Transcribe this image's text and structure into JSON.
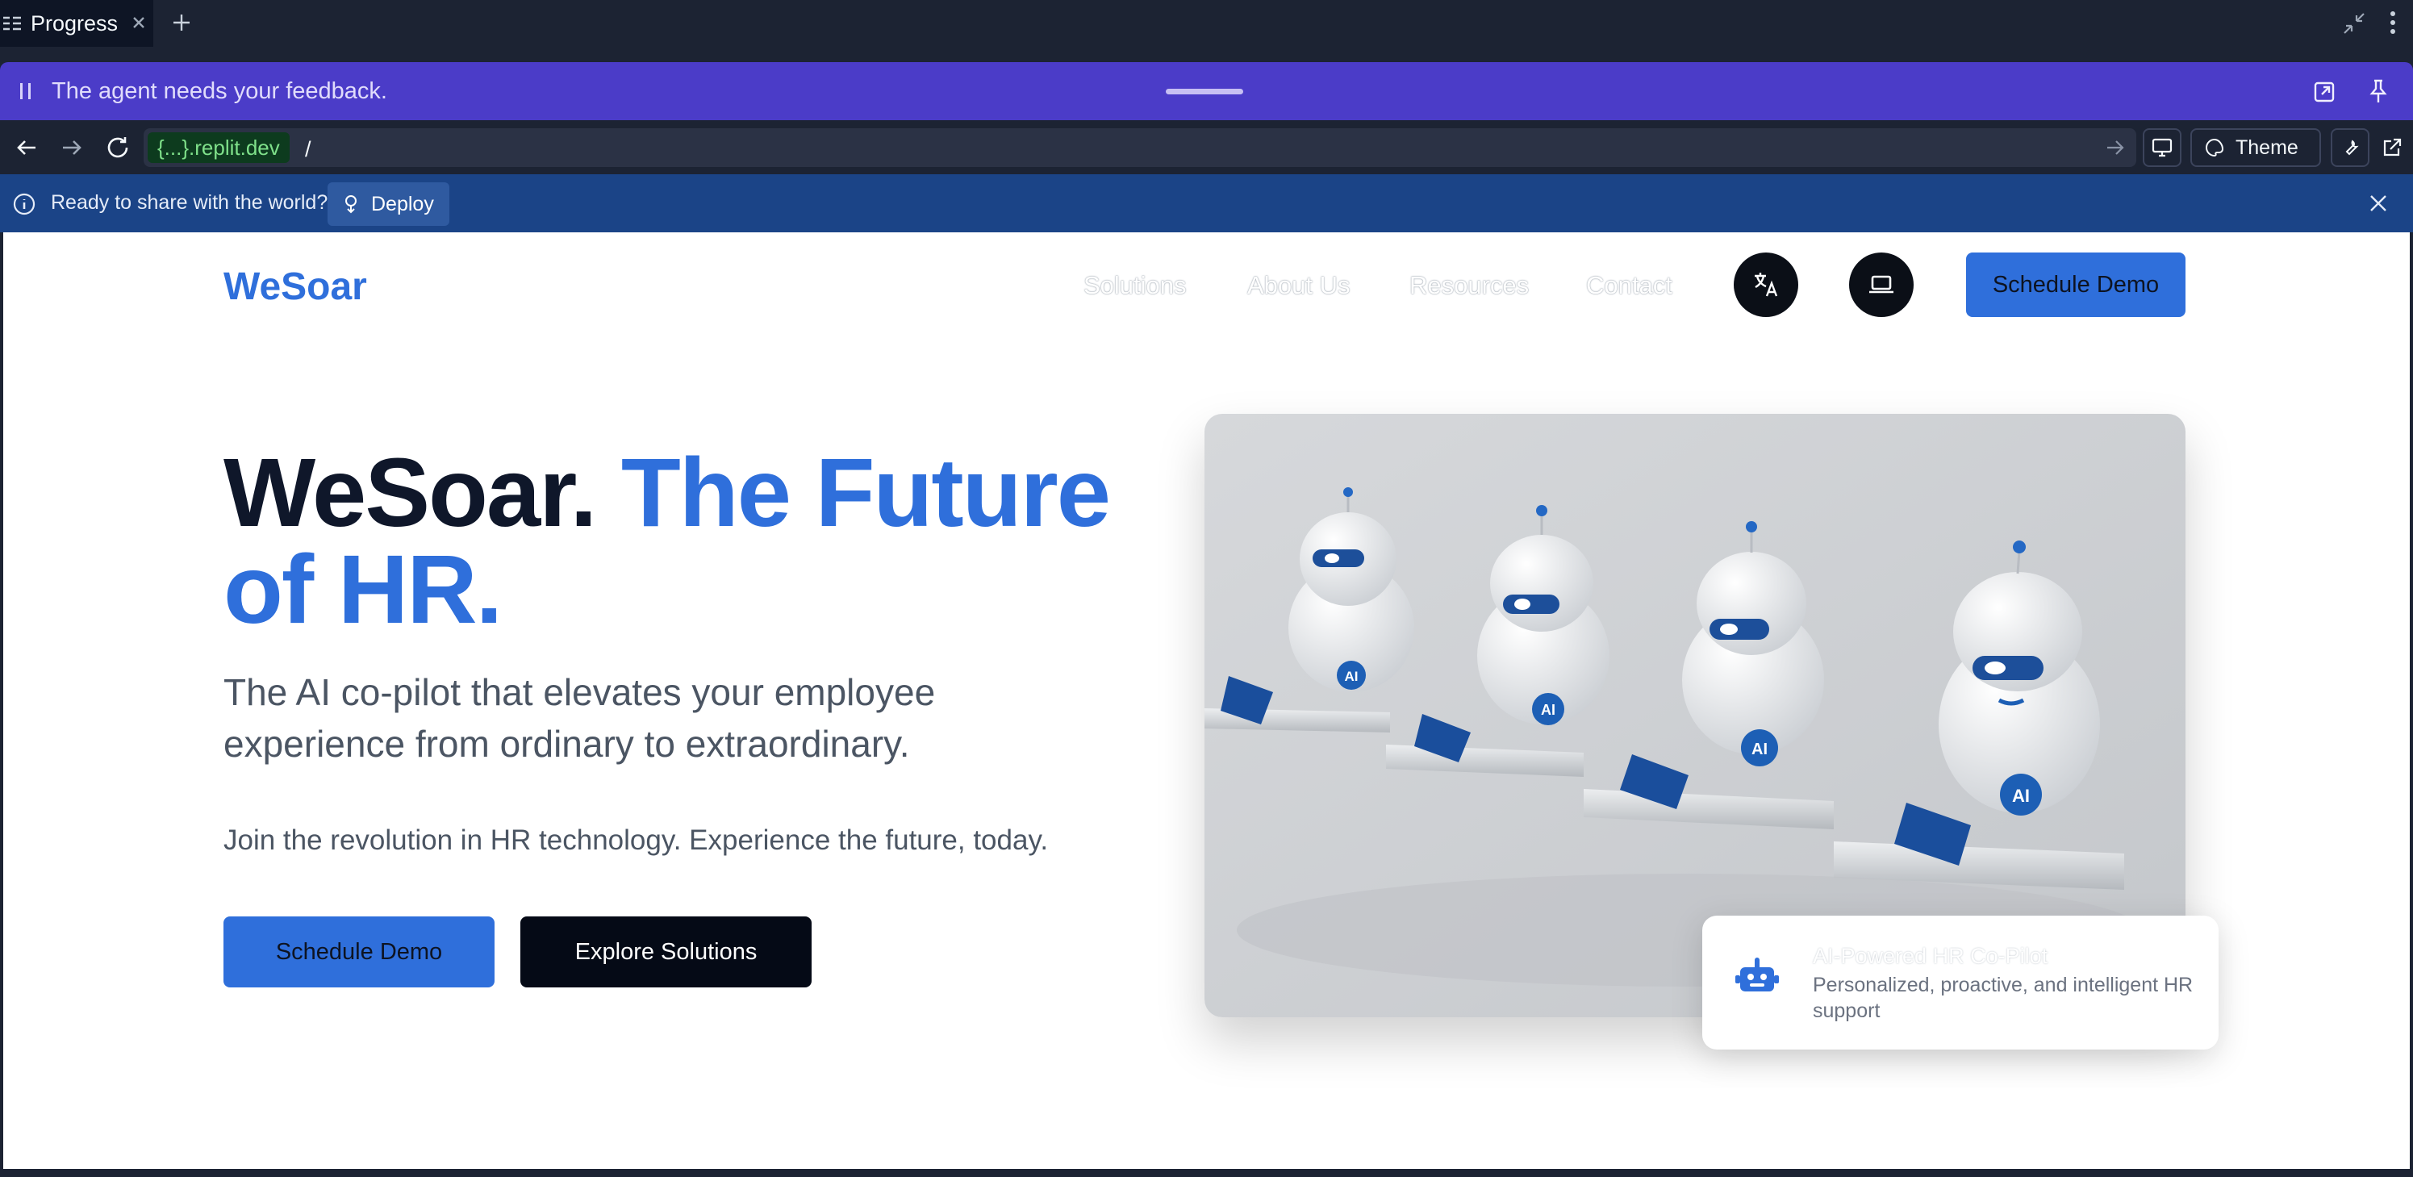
{
  "tab": {
    "title": "Progress"
  },
  "agent_bar": {
    "message": "The agent needs your feedback."
  },
  "browser": {
    "url_host": "{...}.replit.dev",
    "url_path": "/",
    "theme_label": "Theme"
  },
  "deploy_banner": {
    "text": "Ready to share with the world?",
    "button": "Deploy"
  },
  "site": {
    "logo": "WeSoar",
    "nav": [
      "Solutions",
      "About Us",
      "Resources",
      "Contact"
    ],
    "nav_cta": "Schedule Demo",
    "headline_dark": "WeSoar. ",
    "headline_blue": "The Future of HR.",
    "subheadline": "The AI co-pilot that elevates your employee experience from ordinary to extraordinary.",
    "tagline": "Join the revolution in HR technology. Experience the future, today.",
    "cta_primary": "Schedule Demo",
    "cta_secondary": "Explore Solutions",
    "robot_badge": "AI",
    "feature_card": {
      "title": "AI-Powered HR Co-Pilot",
      "description": "Personalized, proactive, and intelligent HR support"
    }
  },
  "colors": {
    "brand_blue": "#2f6fdb",
    "agent_purple": "#4b3cc8",
    "deploy_blue": "#1b4487"
  }
}
